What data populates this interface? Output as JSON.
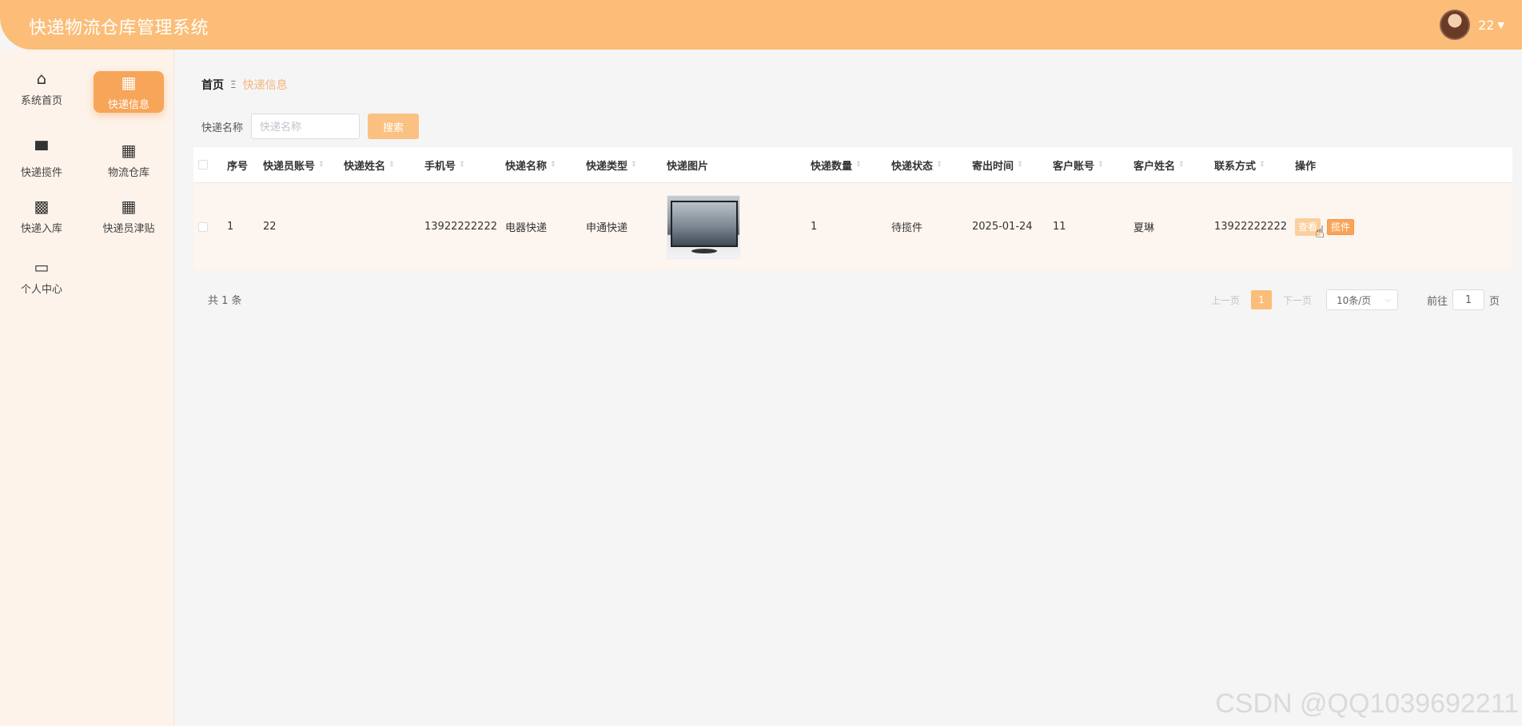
{
  "header": {
    "title": "快递物流仓库管理系统",
    "user": "22",
    "caret": "▼"
  },
  "sidebar": {
    "items": [
      {
        "label": "系统首页",
        "icon": "⌂"
      },
      {
        "label": "快递信息",
        "icon": "▦"
      },
      {
        "label": "快递揽件",
        "icon": "▀"
      },
      {
        "label": "物流仓库",
        "icon": "▦"
      },
      {
        "label": "快递入库",
        "icon": "▩"
      },
      {
        "label": "快递员津贴",
        "icon": "▦"
      },
      {
        "label": "个人中心",
        "icon": "▭"
      }
    ]
  },
  "breadcrumb": {
    "home": "首页",
    "sep": "Ξ",
    "current": "快递信息"
  },
  "search": {
    "label": "快递名称",
    "placeholder": "快递名称",
    "button": "搜索"
  },
  "table": {
    "columns": [
      "序号",
      "快递员账号",
      "快递姓名",
      "手机号",
      "快递名称",
      "快递类型",
      "快递图片",
      "快递数量",
      "快递状态",
      "寄出时间",
      "客户账号",
      "客户姓名",
      "联系方式",
      "操作"
    ],
    "rows": [
      {
        "index": "1",
        "courier_account": "22",
        "courier_name": "",
        "phone": "13922222222",
        "express_name": "电器快递",
        "express_type": "申通快递",
        "quantity": "1",
        "status": "待揽件",
        "send_time": "2025-01-24",
        "customer_account": "11",
        "customer_name": "夏琳",
        "contact": "13922222222",
        "btn_view": "查看",
        "btn_collect": "揽件"
      }
    ]
  },
  "pagination": {
    "total": "共 1 条",
    "prev": "上一页",
    "page": "1",
    "next": "下一页",
    "page_size": "10条/页",
    "goto_label": "前往",
    "goto_value": "1",
    "page_suffix": "页"
  },
  "watermark": "CSDN @QQ1039692211",
  "colors": {
    "accent": "#fbbd78",
    "active": "#f7a559"
  }
}
